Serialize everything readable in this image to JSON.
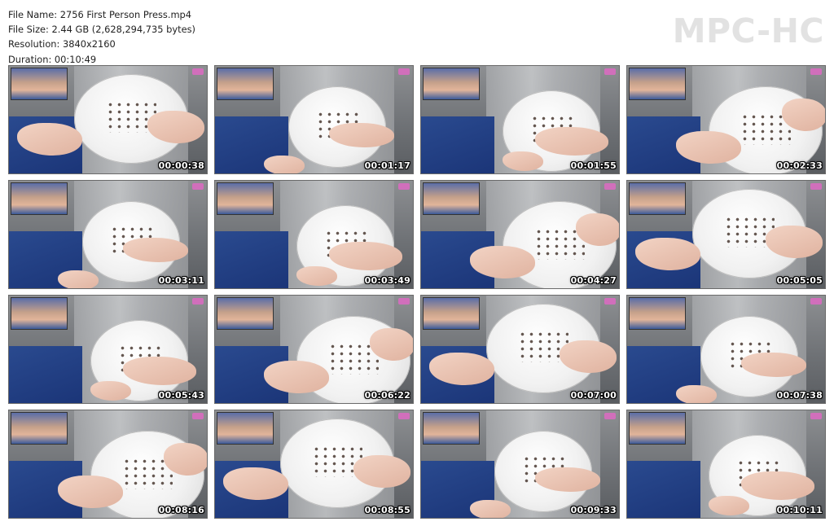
{
  "info": {
    "file_name": "File Name: 2756 First Person Press.mp4",
    "file_size": "File Size: 2.44 GB (2,628,294,735 bytes)",
    "resolution": "Resolution: 3840x2160",
    "duration": "Duration: 00:10:49"
  },
  "brand": "MPC-HC",
  "thumbnails": [
    {
      "time": "00:00:38"
    },
    {
      "time": "00:01:17"
    },
    {
      "time": "00:01:55"
    },
    {
      "time": "00:02:33"
    },
    {
      "time": "00:03:11"
    },
    {
      "time": "00:03:49"
    },
    {
      "time": "00:04:27"
    },
    {
      "time": "00:05:05"
    },
    {
      "time": "00:05:43"
    },
    {
      "time": "00:06:22"
    },
    {
      "time": "00:07:00"
    },
    {
      "time": "00:07:38"
    },
    {
      "time": "00:08:16"
    },
    {
      "time": "00:08:55"
    },
    {
      "time": "00:09:33"
    },
    {
      "time": "00:10:11"
    }
  ]
}
